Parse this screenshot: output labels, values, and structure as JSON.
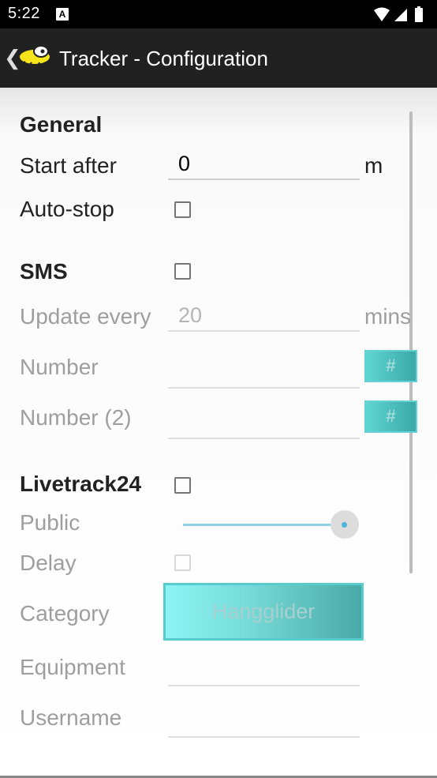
{
  "status_bar": {
    "time": "5:22",
    "notification_badge": "A"
  },
  "app_bar": {
    "title": "Tracker - Configuration"
  },
  "general": {
    "heading": "General",
    "start_after_label": "Start after",
    "start_after_value": "0",
    "start_after_unit": "m",
    "auto_stop_label": "Auto-stop",
    "auto_stop_checked": false
  },
  "sms": {
    "heading": "SMS",
    "enabled": false,
    "update_every_label": "Update every",
    "update_every_value": "20",
    "update_every_unit": "mins",
    "number_label": "Number",
    "number_value": "",
    "number_button": "#",
    "number2_label": "Number (2)",
    "number2_value": "",
    "number2_button": "#"
  },
  "livetrack24": {
    "heading": "Livetrack24",
    "enabled": false,
    "public_label": "Public",
    "public_slider_value": 1.0,
    "delay_label": "Delay",
    "delay_checked": false,
    "category_label": "Category",
    "category_value": "Hangglider",
    "equipment_label": "Equipment",
    "equipment_value": "",
    "username_label": "Username",
    "username_value": ""
  },
  "colors": {
    "app_bar": "#212121",
    "accent_button": "#4ecdc4",
    "slider": "#4fb3d9"
  }
}
